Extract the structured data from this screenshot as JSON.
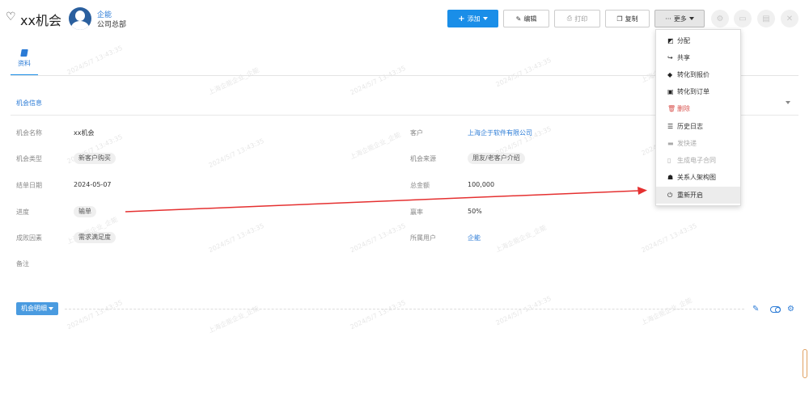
{
  "header": {
    "heart_icon": "heart-outline-icon",
    "title": "xx机会",
    "owner_name": "企能",
    "owner_dept": "公司总部"
  },
  "toolbar": {
    "add_label": "添加",
    "edit_label": "编辑",
    "print_label": "打印",
    "copy_label": "复制",
    "more_label": "更多",
    "accent_color": "#1a8ee8"
  },
  "tabs": [
    {
      "label": "资料",
      "icon": "book-icon"
    }
  ],
  "section": {
    "title": "机会信息"
  },
  "fields": {
    "name": {
      "label": "机会名称",
      "value": "xx机会"
    },
    "type": {
      "label": "机会类型",
      "value": "新客户购买"
    },
    "date": {
      "label": "结单日期",
      "value": "2024-05-07"
    },
    "progress": {
      "label": "进度",
      "value": "输单"
    },
    "reason": {
      "label": "成败因素",
      "value": "需求满足度"
    },
    "remark": {
      "label": "备注",
      "value": ""
    },
    "customer": {
      "label": "客户",
      "value": "上海企于软件有限公司"
    },
    "source": {
      "label": "机会来源",
      "value": "朋友/老客户介绍"
    },
    "amount": {
      "label": "总金额",
      "value": "100,000"
    },
    "win_rate": {
      "label": "赢率",
      "value": "50%"
    },
    "owner": {
      "label": "所属用户",
      "value": "企能"
    }
  },
  "detail": {
    "button_label": "机会明细"
  },
  "more_menu": {
    "items": [
      {
        "label": "分配",
        "icon": "assign-icon"
      },
      {
        "label": "共享",
        "icon": "share-icon"
      },
      {
        "label": "转化到报价",
        "icon": "quote-icon"
      },
      {
        "label": "转化到订单",
        "icon": "order-icon"
      },
      {
        "label": "删除",
        "icon": "trash-icon",
        "color": "#d9534f"
      },
      {
        "label": "历史日志",
        "icon": "list-icon"
      },
      {
        "label": "发快递",
        "icon": "truck-icon",
        "disabled": true
      },
      {
        "label": "生成电子合同",
        "icon": "file-icon",
        "disabled": true
      },
      {
        "label": "关系人架构图",
        "icon": "sitemap-icon"
      },
      {
        "label": "重新开启",
        "icon": "power-icon",
        "highlighted": true
      }
    ]
  },
  "watermark": "2024/5/7 13:43:35",
  "watermark_company": "上海企能企业_企能"
}
